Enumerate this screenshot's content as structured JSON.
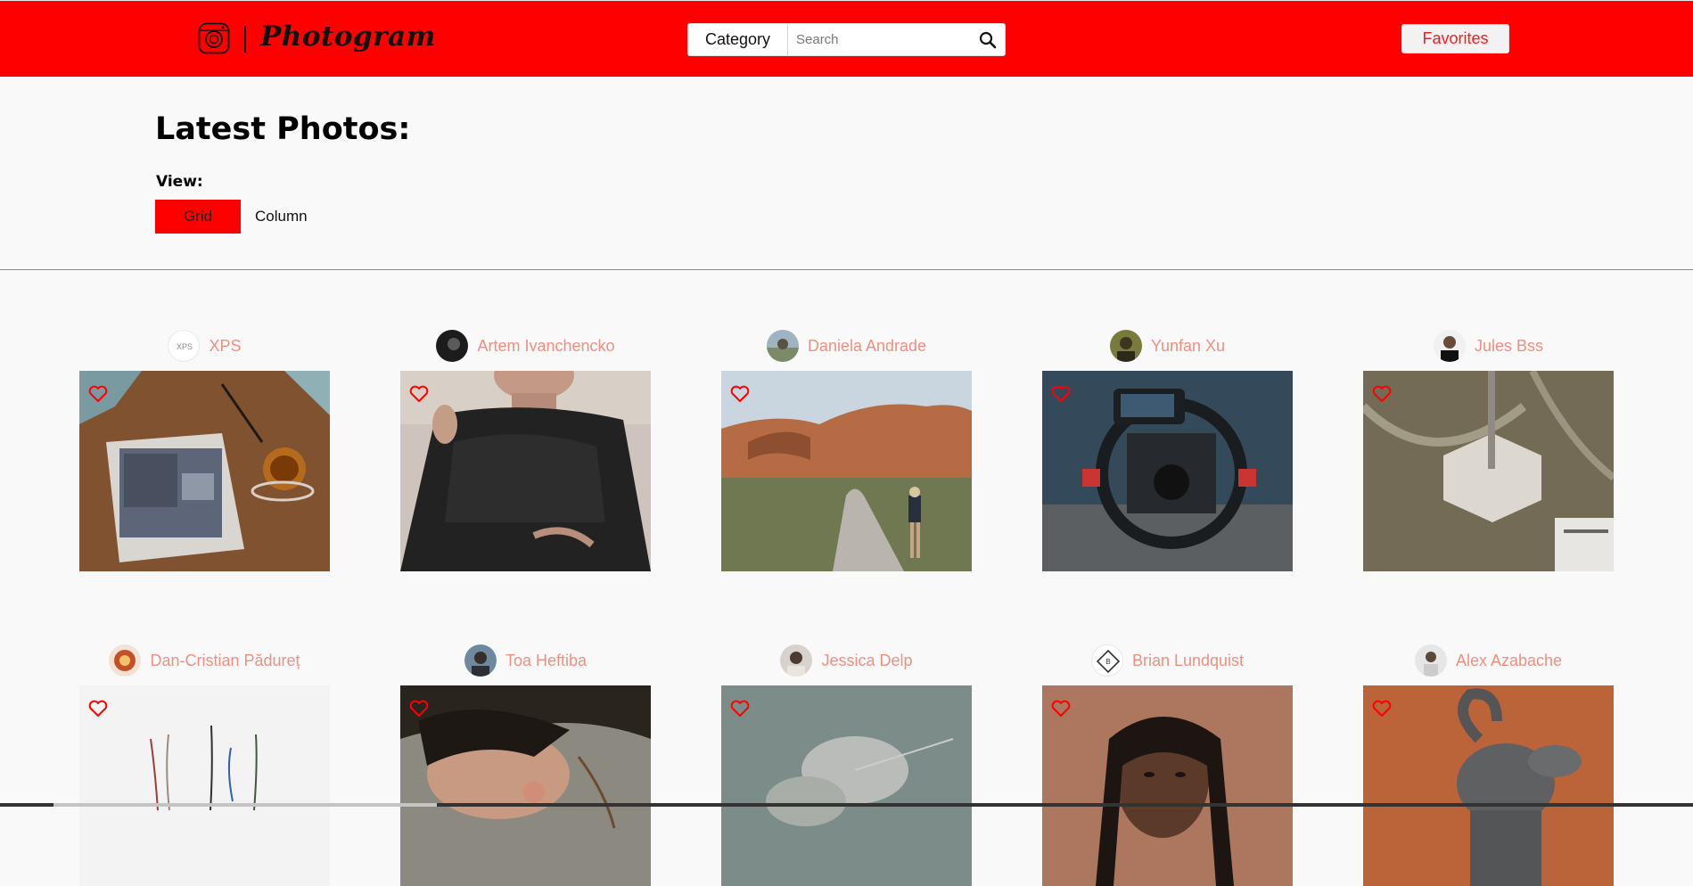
{
  "header": {
    "brand": "Photogram",
    "category_label": "Category",
    "search_placeholder": "Search",
    "favorites_label": "Favorites",
    "icons": [
      "camera-logo-icon",
      "search-icon"
    ]
  },
  "page": {
    "title": "Latest Photos:",
    "view_label": "View:",
    "view_options": [
      "Grid",
      "Column"
    ],
    "active_view": "Grid"
  },
  "photos": [
    {
      "author": "XPS"
    },
    {
      "author": "Artem Ivanchencko"
    },
    {
      "author": "Daniela Andrade"
    },
    {
      "author": "Yunfan Xu"
    },
    {
      "author": "Jules Bss"
    },
    {
      "author": "Dan-Cristian Pădureț"
    },
    {
      "author": "Toa Heftiba"
    },
    {
      "author": "Jessica Delp"
    },
    {
      "author": "Brian Lundquist"
    },
    {
      "author": "Alex Azabache"
    }
  ],
  "colors": {
    "brand_red": "#ff0000",
    "author_name": "#ef8f80",
    "page_background": "#f9f9f9"
  }
}
